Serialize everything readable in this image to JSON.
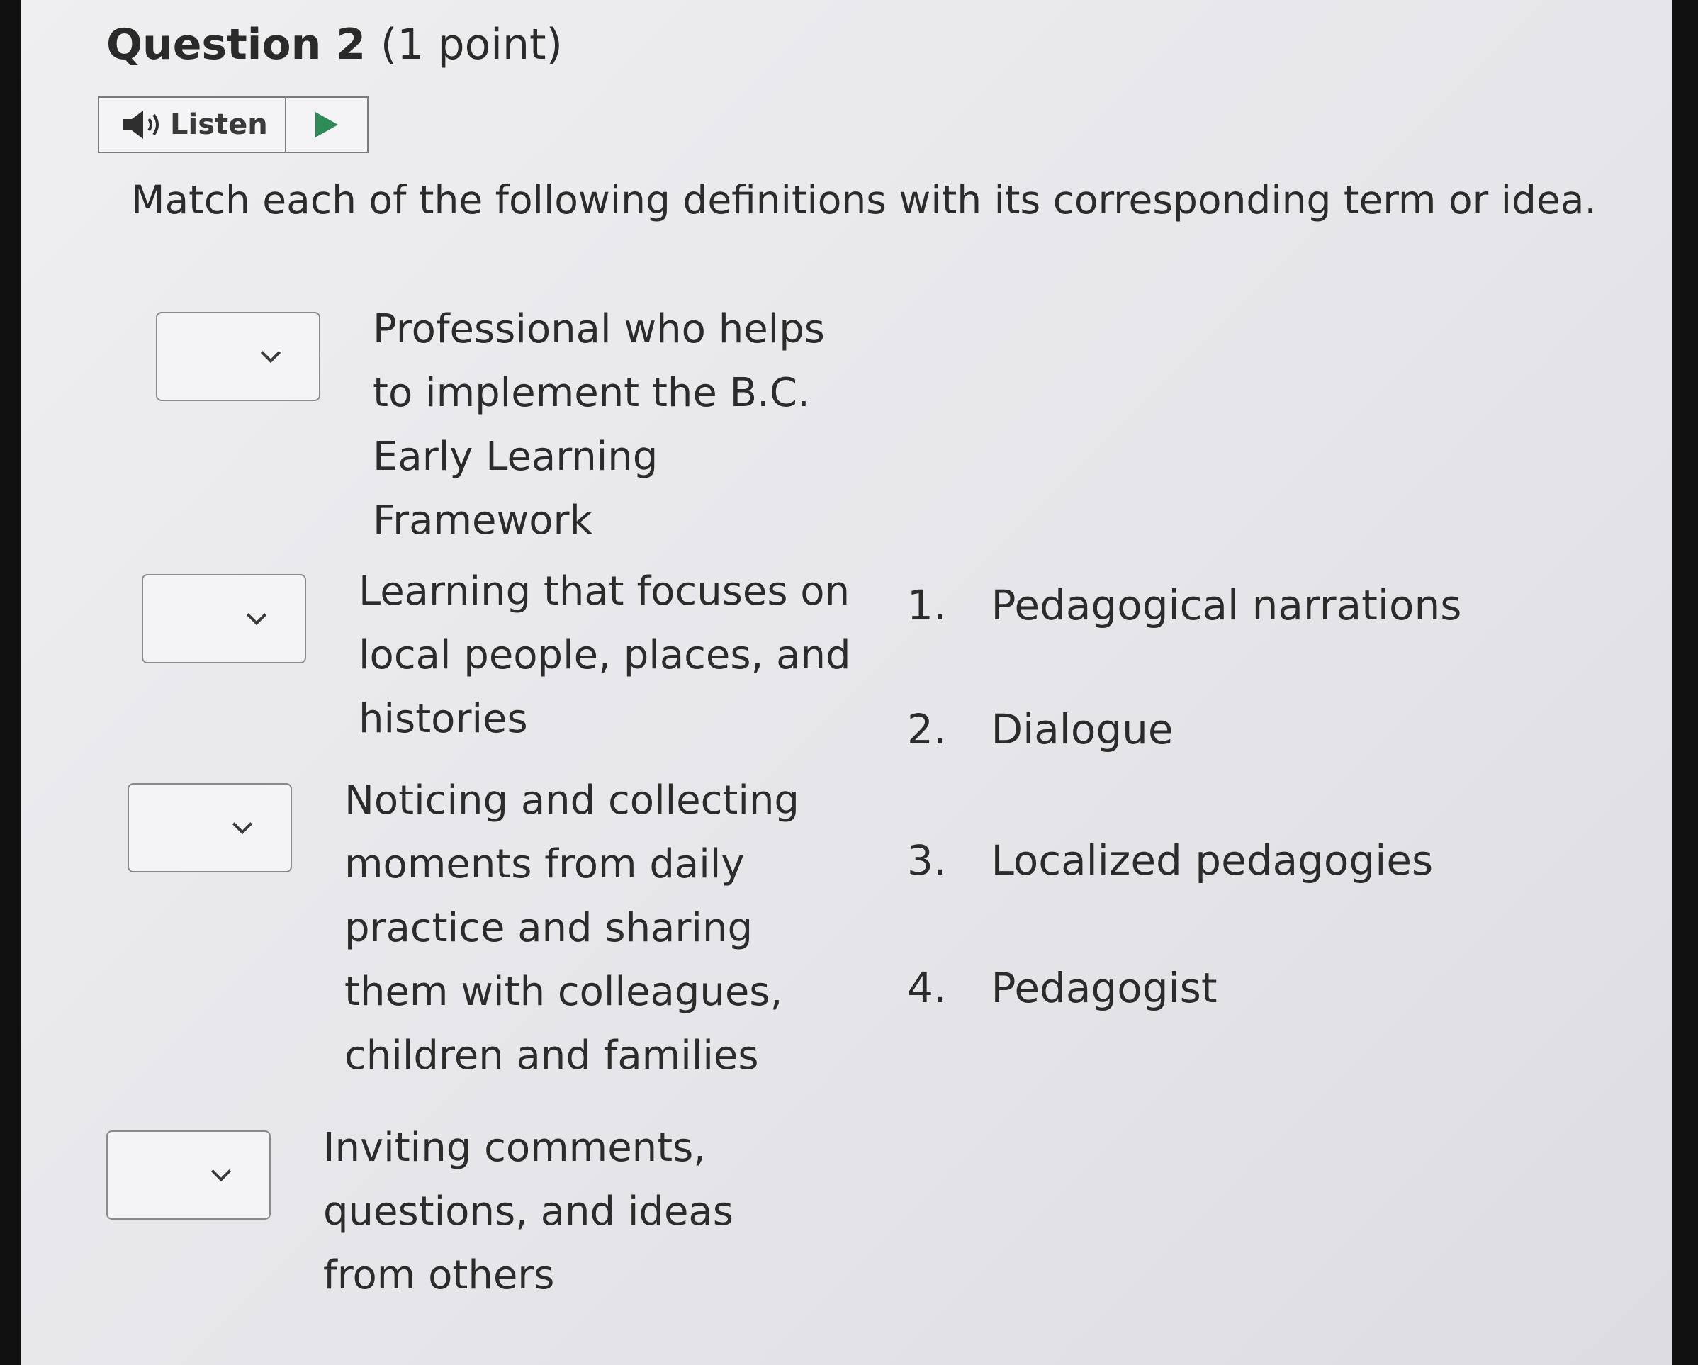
{
  "question": {
    "title": "Question 2",
    "points": "(1 point)"
  },
  "listen": {
    "label": "Listen",
    "speaker_icon": "speaker-icon",
    "play_icon": "play-icon"
  },
  "instructions": "Match each of the following definitions with its corresponding term or idea.",
  "definitions": [
    {
      "text": "Professional who helps to implement the B.C. Early Learning Framework",
      "selected": ""
    },
    {
      "text": "Learning that focuses on local people, places, and histories",
      "selected": ""
    },
    {
      "text": "Noticing and collecting moments from daily practice and sharing them with colleagues, children and families",
      "selected": ""
    },
    {
      "text": "Inviting comments, questions, and ideas from others",
      "selected": ""
    }
  ],
  "terms": [
    {
      "number": "1.",
      "label": "Pedagogical narrations"
    },
    {
      "number": "2.",
      "label": "Dialogue"
    },
    {
      "number": "3.",
      "label": "Localized pedagogies"
    },
    {
      "number": "4.",
      "label": "Pedagogist"
    }
  ],
  "colors": {
    "play_accent": "#2e8b57",
    "text": "#2b2b2b",
    "border": "#8a8a8a"
  }
}
